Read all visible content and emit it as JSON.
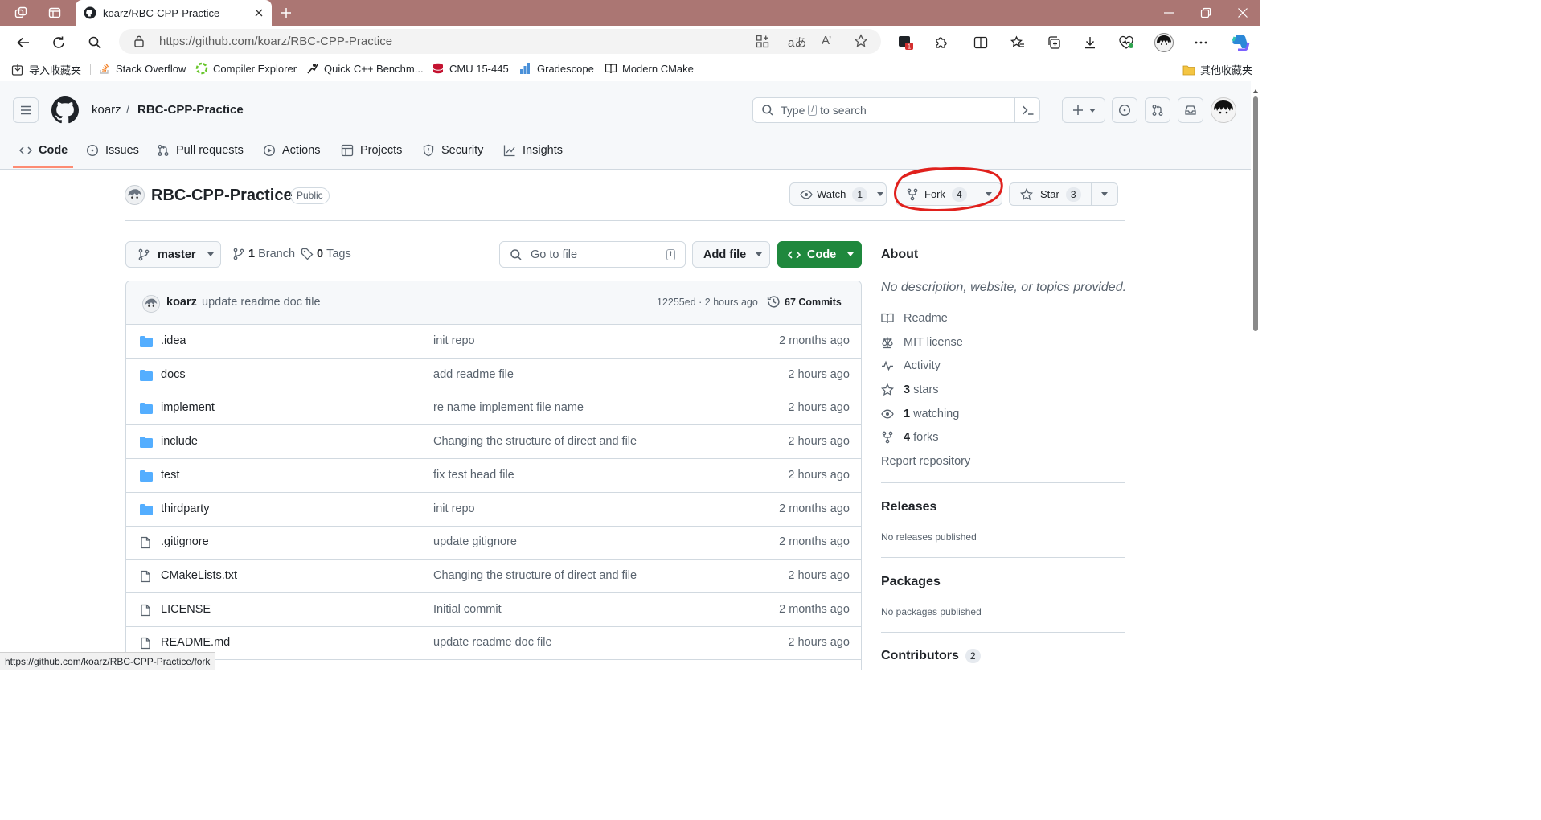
{
  "browser": {
    "tab_title": "koarz/RBC-CPP-Practice",
    "url": "https://github.com/koarz/RBC-CPP-Practice",
    "status_url": "https://github.com/koarz/RBC-CPP-Practice/fork",
    "notification_count": "1"
  },
  "bookmarks": {
    "items": [
      {
        "label": "导入收藏夹",
        "icon": "import-icon"
      },
      {
        "label": "Stack Overflow",
        "icon": "stackoverflow-icon"
      },
      {
        "label": "Compiler Explorer",
        "icon": "compiler-explorer-icon"
      },
      {
        "label": "Quick C++ Benchm...",
        "icon": "benchmark-icon"
      },
      {
        "label": "CMU 15-445",
        "icon": "cmu-icon"
      },
      {
        "label": "Gradescope",
        "icon": "gradescope-icon"
      },
      {
        "label": "Modern CMake",
        "icon": "book-icon"
      }
    ],
    "other": "其他收藏夹"
  },
  "header": {
    "owner": "koarz",
    "separator": "/",
    "repo": "RBC-CPP-Practice",
    "search_pre": "Type",
    "search_key": "/",
    "search_post": "to search"
  },
  "repo_nav": {
    "tabs": [
      {
        "label": "Code",
        "icon": "code-icon"
      },
      {
        "label": "Issues",
        "icon": "issue-icon"
      },
      {
        "label": "Pull requests",
        "icon": "pull-request-icon"
      },
      {
        "label": "Actions",
        "icon": "play-icon"
      },
      {
        "label": "Projects",
        "icon": "table-icon"
      },
      {
        "label": "Security",
        "icon": "shield-icon"
      },
      {
        "label": "Insights",
        "icon": "graph-icon"
      }
    ]
  },
  "repo": {
    "title": "RBC-CPP-Practice",
    "visibility": "Public",
    "watch_label": "Watch",
    "watch_count": "1",
    "fork_label": "Fork",
    "fork_count": "4",
    "star_label": "Star",
    "star_count": "3"
  },
  "toolbar": {
    "branch": "master",
    "branches_count": "1",
    "branches_label": "Branch",
    "tags_count": "0",
    "tags_label": "Tags",
    "goto_placeholder": "Go to file",
    "goto_key": "t",
    "add_file": "Add file",
    "code": "Code"
  },
  "latest_commit": {
    "author": "koarz",
    "message": "update readme doc file",
    "hash_time": "12255ed · 2 hours ago",
    "commits": "67 Commits"
  },
  "files": [
    {
      "name": ".idea",
      "type": "dir",
      "message": "init repo",
      "date": "2 months ago"
    },
    {
      "name": "docs",
      "type": "dir",
      "message": "add readme file",
      "date": "2 hours ago"
    },
    {
      "name": "implement",
      "type": "dir",
      "message": "re name implement file name",
      "date": "2 hours ago"
    },
    {
      "name": "include",
      "type": "dir",
      "message": "Changing the structure of direct and file",
      "date": "2 hours ago"
    },
    {
      "name": "test",
      "type": "dir",
      "message": "fix test head file",
      "date": "2 hours ago"
    },
    {
      "name": "thirdparty",
      "type": "dir",
      "message": "init repo",
      "date": "2 months ago"
    },
    {
      "name": ".gitignore",
      "type": "file",
      "message": "update gitignore",
      "date": "2 months ago"
    },
    {
      "name": "CMakeLists.txt",
      "type": "file",
      "message": "Changing the structure of direct and file",
      "date": "2 hours ago"
    },
    {
      "name": "LICENSE",
      "type": "file",
      "message": "Initial commit",
      "date": "2 months ago"
    },
    {
      "name": "README.md",
      "type": "file",
      "message": "update readme doc file",
      "date": "2 hours ago"
    }
  ],
  "about": {
    "title": "About",
    "description": "No description, website, or topics provided.",
    "readme": "Readme",
    "license": "MIT license",
    "activity": "Activity",
    "stars_count": "3",
    "stars_label": "stars",
    "watching_count": "1",
    "watching_label": "watching",
    "forks_count": "4",
    "forks_label": "forks",
    "report": "Report repository"
  },
  "releases": {
    "title": "Releases",
    "empty": "No releases published"
  },
  "packages": {
    "title": "Packages",
    "empty": "No packages published"
  },
  "contributors": {
    "title": "Contributors",
    "count": "2"
  },
  "colors": {
    "tab_strip": "#ab7673",
    "code_button": "#1f883d",
    "folder": "#54aeff",
    "annotation": "#e0201c",
    "nav_underline": "#fd8c73"
  }
}
